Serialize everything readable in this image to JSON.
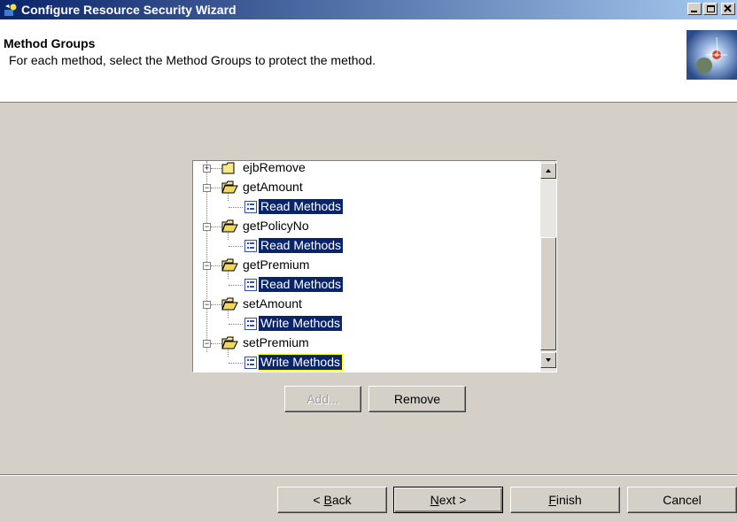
{
  "window": {
    "title": "Configure Resource Security Wizard",
    "controls": [
      "minimize",
      "maximize",
      "close"
    ]
  },
  "header": {
    "title": "Method Groups",
    "description": "For each method, select the Method Groups to protect the method."
  },
  "tree": {
    "nodes": [
      {
        "label": "ejbRemove",
        "type": "method",
        "expanded": false
      },
      {
        "label": "getAmount",
        "type": "method",
        "expanded": true
      },
      {
        "label": "Read Methods",
        "type": "group",
        "selected": true
      },
      {
        "label": "getPolicyNo",
        "type": "method",
        "expanded": true
      },
      {
        "label": "Read Methods",
        "type": "group",
        "selected": true
      },
      {
        "label": "getPremium",
        "type": "method",
        "expanded": true
      },
      {
        "label": "Read Methods",
        "type": "group",
        "selected": true
      },
      {
        "label": "setAmount",
        "type": "method",
        "expanded": true
      },
      {
        "label": "Write Methods",
        "type": "group",
        "selected": true
      },
      {
        "label": "setPremium",
        "type": "method",
        "expanded": true
      },
      {
        "label": "Write Methods",
        "type": "group",
        "selected": true,
        "focused": true
      }
    ]
  },
  "actions": {
    "add_label": "Add...",
    "remove_label": "Remove"
  },
  "footer": {
    "back_label": "< Back",
    "back_mnemonic": "B",
    "next_label": "Next >",
    "next_mnemonic": "N",
    "finish_label": "Finish",
    "finish_mnemonic": "F",
    "cancel_label": "Cancel"
  },
  "colors": {
    "selection": "#0a246a",
    "titlebar_start": "#0a246a",
    "titlebar_end": "#a6caf0",
    "dialog_bg": "#d4d0c8"
  }
}
